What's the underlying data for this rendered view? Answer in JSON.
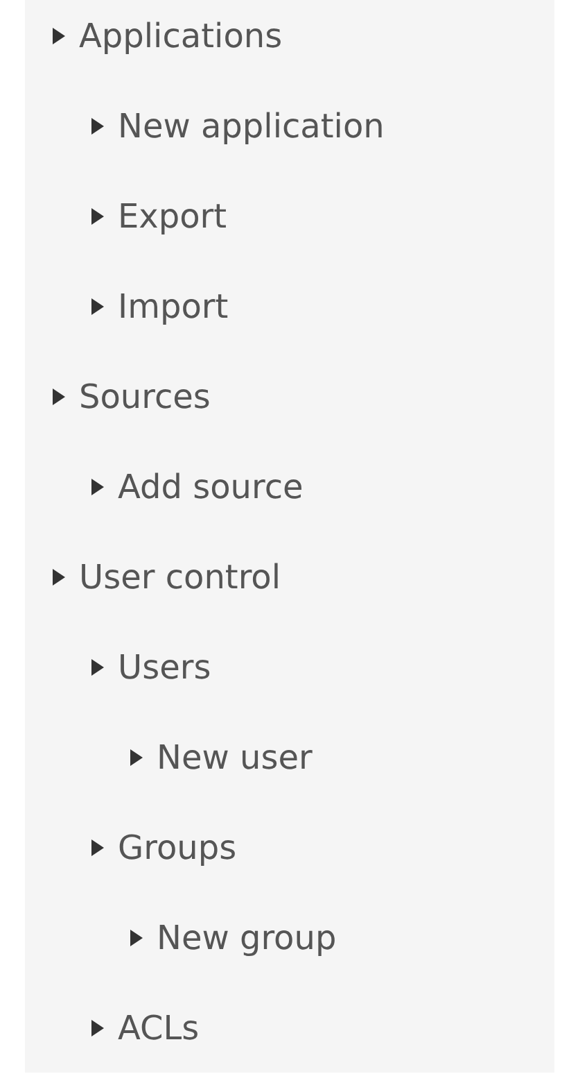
{
  "tree": [
    {
      "label": "Applications",
      "children": [
        {
          "label": "New application"
        },
        {
          "label": "Export"
        },
        {
          "label": "Import"
        }
      ]
    },
    {
      "label": "Sources",
      "children": [
        {
          "label": "Add source"
        }
      ]
    },
    {
      "label": "User control",
      "children": [
        {
          "label": "Users",
          "children": [
            {
              "label": "New user"
            }
          ]
        },
        {
          "label": "Groups",
          "children": [
            {
              "label": "New group"
            }
          ]
        },
        {
          "label": "ACLs"
        }
      ]
    }
  ]
}
